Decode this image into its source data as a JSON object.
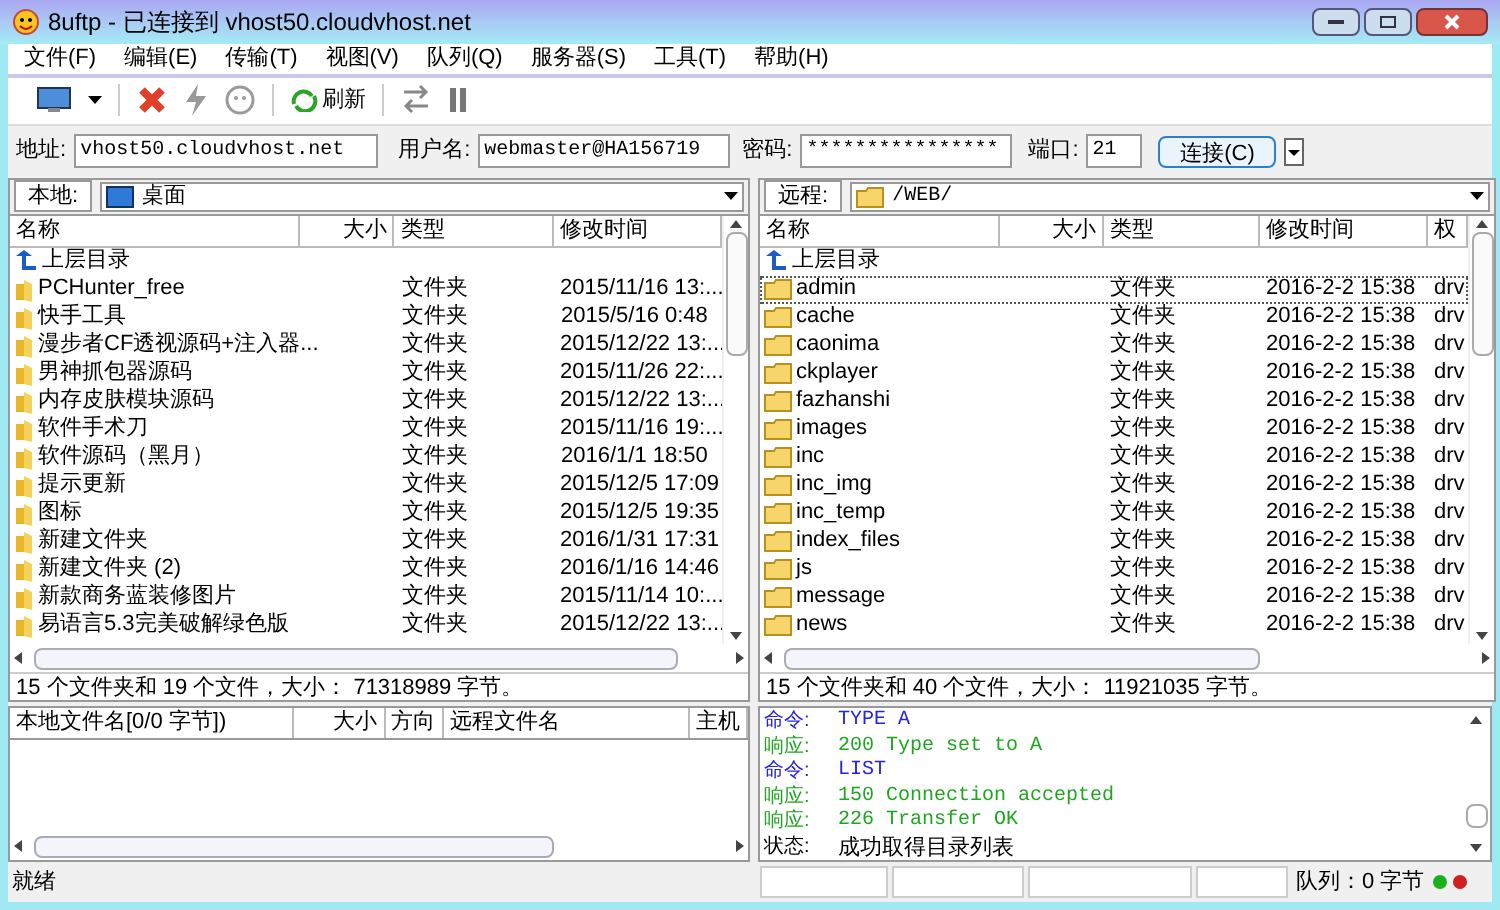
{
  "window": {
    "title": "8uftp - 已连接到 vhost50.cloudvhost.net"
  },
  "menu": [
    "文件(F)",
    "编辑(E)",
    "传输(T)",
    "视图(V)",
    "队列(Q)",
    "服务器(S)",
    "工具(T)",
    "帮助(H)"
  ],
  "toolbar": {
    "refresh_label": "刷新"
  },
  "connection": {
    "address_label": "地址:",
    "address": "vhost50.cloudvhost.net",
    "user_label": "用户名:",
    "user": "webmaster@HA156719",
    "password_label": "密码:",
    "password": "****************",
    "port_label": "端口:",
    "port": "21",
    "connect_label": "连接(C)"
  },
  "local": {
    "label": "本地:",
    "path": "桌面",
    "columns": [
      "名称",
      "大小",
      "类型",
      "修改时间"
    ],
    "parent_dir": "上层目录",
    "rows": [
      {
        "name": "PCHunter_free",
        "type": "文件夹",
        "modified": "2015/11/16 13:...",
        "selected": false
      },
      {
        "name": "快手工具",
        "type": "文件夹",
        "modified": "2015/5/16 0:48",
        "selected": false
      },
      {
        "name": "漫步者CF透视源码+注入器...",
        "type": "文件夹",
        "modified": "2015/12/22 13:...",
        "selected": false
      },
      {
        "name": "男神抓包器源码",
        "type": "文件夹",
        "modified": "2015/11/26 22:...",
        "selected": false
      },
      {
        "name": "内存皮肤模块源码",
        "type": "文件夹",
        "modified": "2015/12/22 13:...",
        "selected": false
      },
      {
        "name": "软件手术刀",
        "type": "文件夹",
        "modified": "2015/11/16 19:...",
        "selected": false
      },
      {
        "name": "软件源码（黑月）",
        "type": "文件夹",
        "modified": "2016/1/1 18:50",
        "selected": false
      },
      {
        "name": "提示更新",
        "type": "文件夹",
        "modified": "2015/12/5 17:09",
        "selected": false
      },
      {
        "name": "图标",
        "type": "文件夹",
        "modified": "2015/12/5 19:35",
        "selected": false
      },
      {
        "name": "新建文件夹",
        "type": "文件夹",
        "modified": "2016/1/31 17:31",
        "selected": false
      },
      {
        "name": "新建文件夹 (2)",
        "type": "文件夹",
        "modified": "2016/1/16 14:46",
        "selected": false
      },
      {
        "name": "新款商务蓝装修图片",
        "type": "文件夹",
        "modified": "2015/11/14 10:...",
        "selected": false
      },
      {
        "name": "易语言5.3完美破解绿色版",
        "type": "文件夹",
        "modified": "2015/12/22 13:...",
        "selected": false
      }
    ],
    "status": "15 个文件夹和 19 个文件，大小： 71318989 字节。"
  },
  "remote": {
    "label": "远程:",
    "path": "/WEB/",
    "columns": [
      "名称",
      "大小",
      "类型",
      "修改时间",
      "权"
    ],
    "parent_dir": "上层目录",
    "rows": [
      {
        "name": "admin",
        "type": "文件夹",
        "modified": "2016-2-2 15:38",
        "perm": "drv",
        "selected": true
      },
      {
        "name": "cache",
        "type": "文件夹",
        "modified": "2016-2-2 15:38",
        "perm": "drv",
        "selected": false
      },
      {
        "name": "caonima",
        "type": "文件夹",
        "modified": "2016-2-2 15:38",
        "perm": "drv",
        "selected": false
      },
      {
        "name": "ckplayer",
        "type": "文件夹",
        "modified": "2016-2-2 15:38",
        "perm": "drv",
        "selected": false
      },
      {
        "name": "fazhanshi",
        "type": "文件夹",
        "modified": "2016-2-2 15:38",
        "perm": "drv",
        "selected": false
      },
      {
        "name": "images",
        "type": "文件夹",
        "modified": "2016-2-2 15:38",
        "perm": "drv",
        "selected": false
      },
      {
        "name": "inc",
        "type": "文件夹",
        "modified": "2016-2-2 15:38",
        "perm": "drv",
        "selected": false
      },
      {
        "name": "inc_img",
        "type": "文件夹",
        "modified": "2016-2-2 15:38",
        "perm": "drv",
        "selected": false
      },
      {
        "name": "inc_temp",
        "type": "文件夹",
        "modified": "2016-2-2 15:38",
        "perm": "drv",
        "selected": false
      },
      {
        "name": "index_files",
        "type": "文件夹",
        "modified": "2016-2-2 15:38",
        "perm": "drv",
        "selected": false
      },
      {
        "name": "js",
        "type": "文件夹",
        "modified": "2016-2-2 15:38",
        "perm": "drv",
        "selected": false
      },
      {
        "name": "message",
        "type": "文件夹",
        "modified": "2016-2-2 15:38",
        "perm": "drv",
        "selected": false
      },
      {
        "name": "news",
        "type": "文件夹",
        "modified": "2016-2-2 15:38",
        "perm": "drv",
        "selected": false
      }
    ],
    "status": "15 个文件夹和 40 个文件，大小： 11921035 字节。"
  },
  "queue": {
    "columns": [
      "本地文件名[0/0 字节])",
      "大小",
      "方向",
      "远程文件名",
      "主机"
    ]
  },
  "log": [
    {
      "kind": "command",
      "label": "命令:",
      "text": "TYPE A"
    },
    {
      "kind": "response",
      "label": "响应:",
      "text": "200 Type set to A"
    },
    {
      "kind": "command",
      "label": "命令:",
      "text": "LIST"
    },
    {
      "kind": "response",
      "label": "响应:",
      "text": "150 Connection accepted"
    },
    {
      "kind": "response",
      "label": "响应:",
      "text": "226 Transfer OK"
    },
    {
      "kind": "status",
      "label": "状态:",
      "text": "成功取得目录列表"
    }
  ],
  "status_bar": {
    "text": "就绪",
    "queue": "队列：0 字节"
  }
}
